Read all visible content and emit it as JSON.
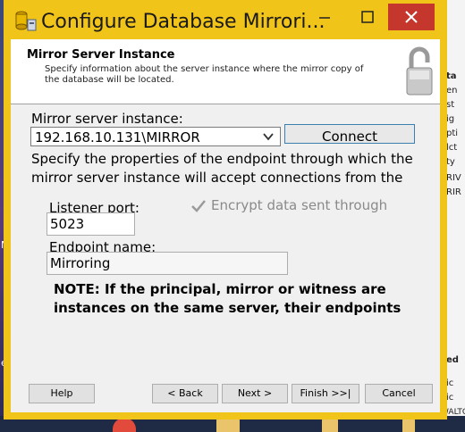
{
  "window": {
    "title": "Configure Database Mirrori...",
    "minimize_icon": "minimize-icon",
    "maximize_icon": "maximize-icon",
    "close_icon": "close-icon",
    "titlebar_color": "#f0c419",
    "close_color": "#c5372c"
  },
  "header": {
    "title": "Mirror Server Instance",
    "description": "Specify information about the server instance where the mirror copy of the database will be located.",
    "icon": "padlock-icon"
  },
  "form": {
    "mirror_label": "Mirror server instance:",
    "mirror_value": "192.168.10.131\\MIRROR",
    "connect_label": "Connect",
    "instructions": "Specify the properties of the endpoint through which the mirror server instance will accept connections from the",
    "listener_label": "Listener port:",
    "listener_value": "5023",
    "encrypt_label": "Encrypt data sent through",
    "encrypt_checked": true,
    "endpoint_label": "Endpoint name:",
    "endpoint_value": "Mirroring",
    "note": "NOTE: If the principal, mirror or witness are instances on the same server, their endpoints"
  },
  "buttons": {
    "help": "Help",
    "back": "< Back",
    "next": "Next >",
    "finish": "Finish >>|",
    "cancel": "Cancel"
  },
  "background": {
    "right_fragments": [
      "ta",
      "en",
      "st",
      "ig",
      "pti",
      "lct",
      "ty",
      "RIV",
      "RIR",
      "ed",
      "ic",
      "ic",
      "WALTO"
    ],
    "left_fragments": [
      "N",
      "e"
    ]
  }
}
